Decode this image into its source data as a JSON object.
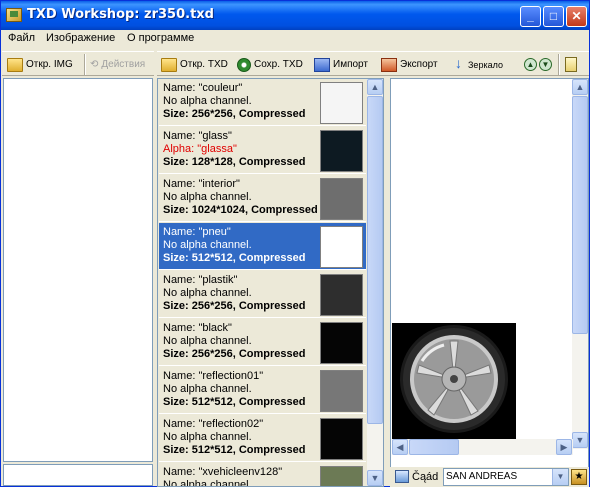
{
  "window": {
    "title": "TXD Workshop: zr350.txd",
    "min_glyph": "_",
    "max_glyph": "□",
    "close_glyph": "✕"
  },
  "menu": [
    "Файл",
    "Изображение",
    "О программе"
  ],
  "left_toolbar": {
    "open_img": "Откр. IMG",
    "actions": "Действия"
  },
  "main_toolbar": {
    "open_txd": "Откр. TXD",
    "save_txd": "Сохр. TXD",
    "import": "Импорт",
    "export": "Экспорт",
    "mirror": "Зеркало",
    "up_glyph": "▲",
    "down_glyph": "▼"
  },
  "textures": [
    {
      "name": "Name: \"couleur\"",
      "alpha": "No alpha channel.",
      "size": "Size: 256*256, Compressed",
      "alpha_red": false,
      "selected": false,
      "thumb_color": "#F5F5F5"
    },
    {
      "name": "Name: \"glass\"",
      "alpha": "Alpha: \"glassa\"",
      "size": "Size: 128*128, Compressed",
      "alpha_red": true,
      "selected": false,
      "thumb_color": "#0D1A22"
    },
    {
      "name": "Name: \"interior\"",
      "alpha": "No alpha channel.",
      "size": "Size: 1024*1024, Compressed",
      "alpha_red": false,
      "selected": false,
      "thumb_color": "#6E6E6E"
    },
    {
      "name": "Name: \"pneu\"",
      "alpha": "No alpha channel.",
      "size": "Size: 512*512, Compressed",
      "alpha_red": false,
      "selected": true,
      "thumb_color": "#FFFFFF"
    },
    {
      "name": "Name: \"plastik\"",
      "alpha": "No alpha channel.",
      "size": "Size: 256*256, Compressed",
      "alpha_red": false,
      "selected": false,
      "thumb_color": "#2E2E2E"
    },
    {
      "name": "Name: \"black\"",
      "alpha": "No alpha channel.",
      "size": "Size: 256*256, Compressed",
      "alpha_red": false,
      "selected": false,
      "thumb_color": "#050505"
    },
    {
      "name": "Name: \"reflection01\"",
      "alpha": "No alpha channel.",
      "size": "Size: 512*512, Compressed",
      "alpha_red": false,
      "selected": false,
      "thumb_color": "#777777"
    },
    {
      "name": "Name: \"reflection02\"",
      "alpha": "No alpha channel.",
      "size": "Size: 512*512, Compressed",
      "alpha_red": false,
      "selected": false,
      "thumb_color": "#050505"
    },
    {
      "name": "Name: \"xvehicleenv128\"",
      "alpha": "No alpha channel.",
      "size": "",
      "alpha_red": false,
      "selected": false,
      "thumb_color": "#6C7A55"
    }
  ],
  "status": {
    "label": "Čąád",
    "combo_value": "SAN ANDREAS"
  }
}
